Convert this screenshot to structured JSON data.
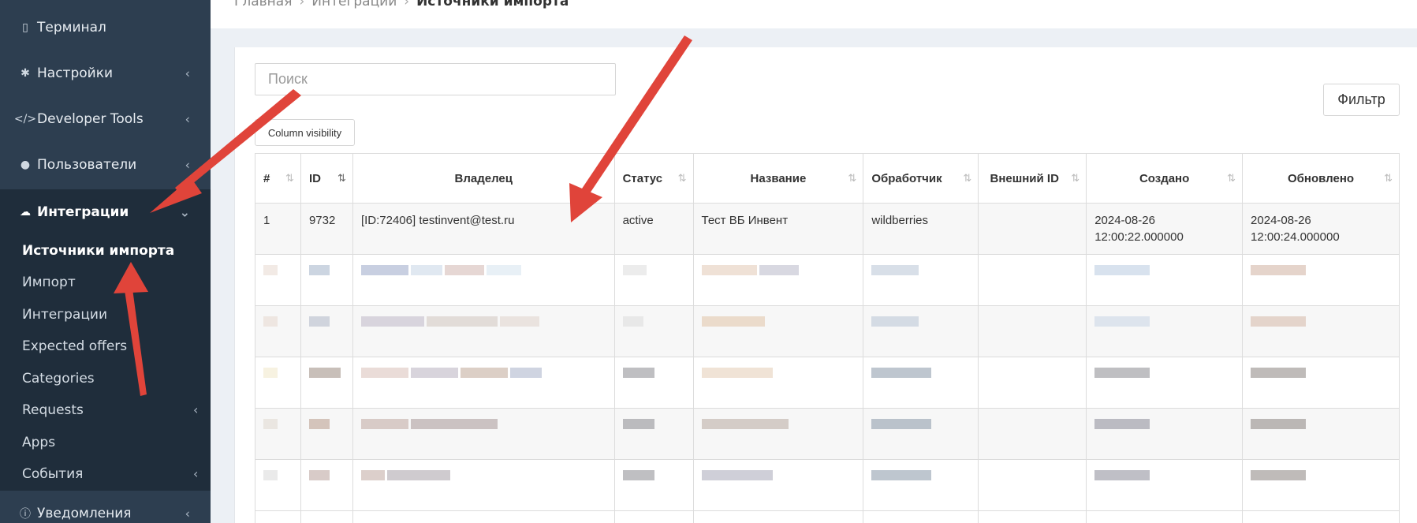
{
  "sidebar": {
    "items": [
      {
        "label": "Терминал",
        "icon": "mobile-icon"
      },
      {
        "label": "Настройки",
        "icon": "gear-icon",
        "chevron": "‹"
      },
      {
        "label": "Developer Tools",
        "icon": "code-icon",
        "chevron": "‹"
      },
      {
        "label": "Пользователи",
        "icon": "user-icon",
        "chevron": "‹"
      },
      {
        "label": "Интеграции",
        "icon": "cloud-download-icon",
        "chevron": "⌄"
      }
    ],
    "submenu": [
      {
        "label": "Источники импорта"
      },
      {
        "label": "Импорт"
      },
      {
        "label": "Интеграции"
      },
      {
        "label": "Expected offers"
      },
      {
        "label": "Categories"
      },
      {
        "label": "Requests",
        "chevron": "‹"
      },
      {
        "label": "Apps"
      },
      {
        "label": "События",
        "chevron": "‹"
      }
    ],
    "bottom": {
      "label": "Уведомления",
      "icon": "info-icon",
      "chevron": "‹"
    }
  },
  "breadcrumb": {
    "items": [
      "Главная",
      "Интеграции"
    ],
    "current": "Источники импорта"
  },
  "search": {
    "placeholder": "Поиск"
  },
  "toolbar": {
    "column_visibility": "Column visibility",
    "filter": "Фильтр"
  },
  "table": {
    "columns": [
      "#",
      "ID",
      "Владелец",
      "Статус",
      "Название",
      "Обработчик",
      "Внешний ID",
      "Создано",
      "Обновлено"
    ],
    "rows": [
      {
        "num": "1",
        "id": "9732",
        "owner": "[ID:72406] testinvent@test.ru",
        "status": "active",
        "name": "Тест ВБ Инвент",
        "handler": "wildberries",
        "external_id": "",
        "created": "2024-08-26 12:00:22.000000",
        "updated": "2024-08-26 12:00:24.000000"
      },
      {
        "num": "7",
        "id": "9726",
        "owner": "[ID:135345] ИП Савенкова Юлия",
        "status": "active",
        "name": "ИП Савенкова WB",
        "handler": "wildberries",
        "external_id": "",
        "created": "2024-08-08",
        "updated": "2024-08-08"
      }
    ]
  },
  "colors": {
    "sidebar": "#2d3e50",
    "sidebar_active": "#1f2d3b",
    "arrow": "#e0443a"
  }
}
